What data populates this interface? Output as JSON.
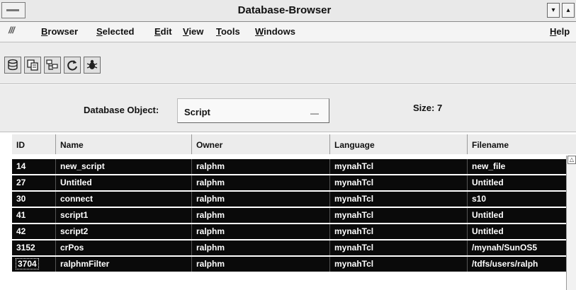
{
  "window": {
    "title": "Database-Browser",
    "minimize_glyph": "▾",
    "maximize_glyph": "▴"
  },
  "menubar": {
    "logo_text": "///",
    "items": [
      {
        "label": "Browser"
      },
      {
        "label": "Selected"
      },
      {
        "label": "Edit"
      },
      {
        "label": "View"
      },
      {
        "label": "Tools"
      },
      {
        "label": "Windows"
      }
    ],
    "help_label": "Help"
  },
  "toolbar": {
    "tools": [
      {
        "icon": "database-icon"
      },
      {
        "icon": "copy-icon"
      },
      {
        "icon": "folder-tree-icon"
      },
      {
        "icon": "refresh-icon"
      },
      {
        "icon": "debug-icon"
      }
    ]
  },
  "selector": {
    "label": "Database Object:",
    "value": "Script",
    "dropdown_glyph": "—",
    "size_text": "Size: 7"
  },
  "table": {
    "columns": [
      "ID",
      "Name",
      "Owner",
      "Language",
      "Filename"
    ],
    "rows": [
      {
        "id": "14",
        "name": "new_script",
        "owner": "ralphm",
        "language": "mynahTcl",
        "filename": "new_file"
      },
      {
        "id": "27",
        "name": "Untitled",
        "owner": "ralphm",
        "language": "mynahTcl",
        "filename": "Untitled"
      },
      {
        "id": "30",
        "name": "connect",
        "owner": "ralphm",
        "language": "mynahTcl",
        "filename": "s10"
      },
      {
        "id": "41",
        "name": "script1",
        "owner": "ralphm",
        "language": "mynahTcl",
        "filename": "Untitled"
      },
      {
        "id": "42",
        "name": "script2",
        "owner": "ralphm",
        "language": "mynahTcl",
        "filename": "Untitled"
      },
      {
        "id": "3152",
        "name": "crPos",
        "owner": "ralphm",
        "language": "mynahTcl",
        "filename": "/mynah/SunOS5"
      },
      {
        "id": "3704",
        "name": "ralphmFilter",
        "owner": "ralphm",
        "language": "mynahTcl",
        "filename": "/tdfs/users/ralph"
      }
    ],
    "scroll_up_glyph": "△"
  }
}
